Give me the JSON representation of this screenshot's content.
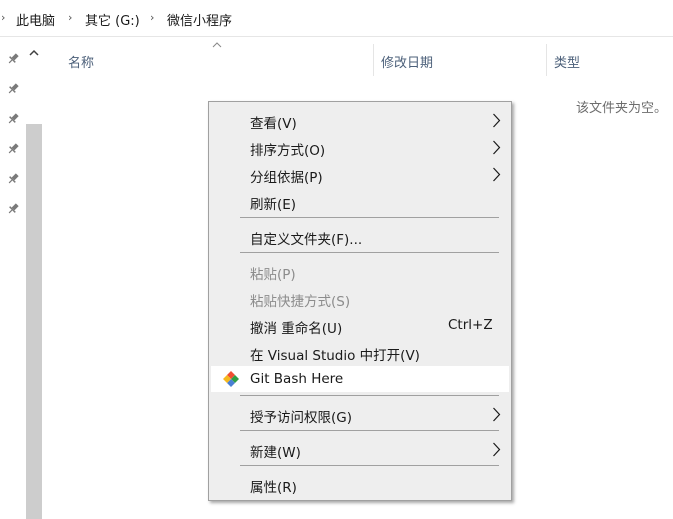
{
  "breadcrumb": {
    "items": [
      "此电脑",
      "其它 (G:)",
      "微信小程序"
    ]
  },
  "columns": {
    "name": "名称",
    "modified": "修改日期",
    "type": "类型"
  },
  "folder": {
    "empty_message": "该文件夹为空。"
  },
  "context_menu": {
    "view": "查看(V)",
    "sort_by": "排序方式(O)",
    "group_by": "分组依据(P)",
    "refresh": "刷新(E)",
    "customize": "自定义文件夹(F)...",
    "paste": "粘贴(P)",
    "paste_shortcut": "粘贴快捷方式(S)",
    "undo_rename": "撤消 重命名(U)",
    "undo_rename_shortcut": "Ctrl+Z",
    "open_in_vs": "在 Visual Studio 中打开(V)",
    "git_bash": "Git Bash Here",
    "give_access": "授予访问权限(G)",
    "new": "新建(W)",
    "properties": "属性(R)"
  },
  "colors": {
    "menu_background": "#eeeeee",
    "menu_border": "#a0a0a0",
    "header_text": "#4c607a",
    "disabled_text": "#8c8c8c",
    "scrollbar": "#cdcdcd"
  },
  "icons": {
    "pin": "pin-icon",
    "git": "git-logo-icon",
    "submenu": "chevron-right-icon",
    "scroll_up": "chevron-up-icon",
    "breadcrumb_sep": "chevron-right-small-icon"
  }
}
